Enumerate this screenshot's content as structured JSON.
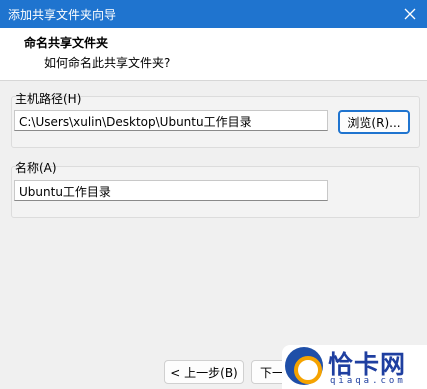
{
  "window": {
    "title": "添加共享文件夹向导"
  },
  "header": {
    "title": "命名共享文件夹",
    "subtitle": "如何命名此共享文件夹?"
  },
  "host_path": {
    "label": "主机路径(H)",
    "value": "C:\\Users\\xulin\\Desktop\\Ubuntu工作目录",
    "browse_label": "浏览(R)..."
  },
  "name": {
    "label": "名称(A)",
    "value": "Ubuntu工作目录"
  },
  "footer": {
    "back_label": "< 上一步(B)",
    "next_label": "下一"
  },
  "watermark": {
    "text": "恰卡网",
    "sub": "qiaqa.com"
  }
}
